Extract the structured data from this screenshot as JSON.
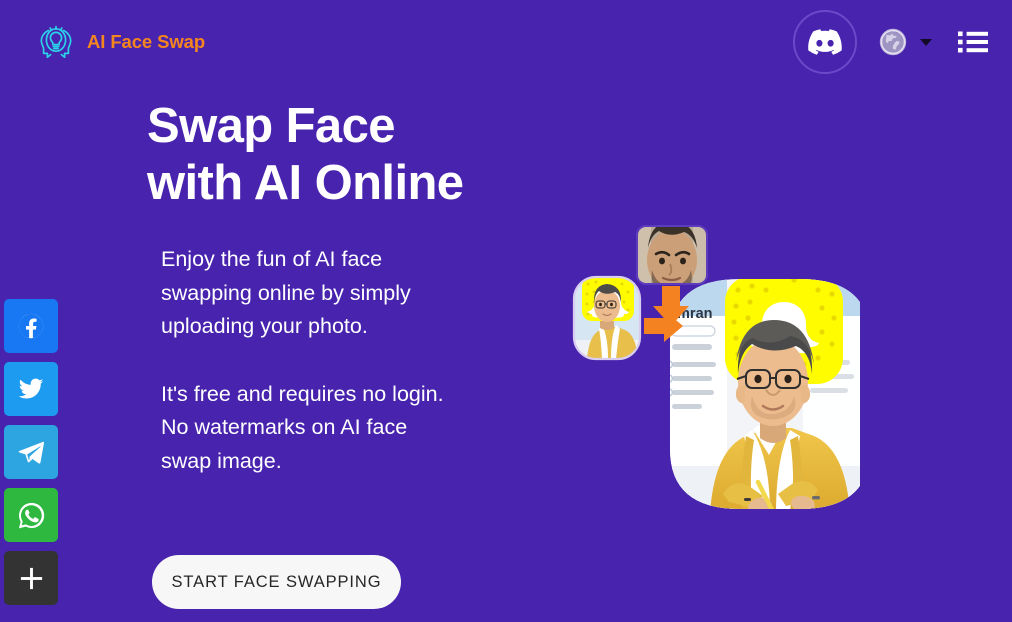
{
  "page": {
    "background_color": "#4723AE",
    "accent_orange": "#F5861F"
  },
  "header": {
    "brand": {
      "logo_icon": "head-lightbulb-icon",
      "text": "AI Face Swap",
      "text_color": "#F5861F"
    },
    "actions": [
      {
        "name": "discord-button",
        "icon": "discord-icon",
        "label": "Discord"
      },
      {
        "name": "language-selector",
        "icon": "globe-icon",
        "label": "Language"
      },
      {
        "name": "menu-button",
        "icon": "list-menu-icon",
        "label": "Menu"
      }
    ]
  },
  "social_rail": {
    "items": [
      {
        "name": "share-facebook",
        "icon": "facebook-icon",
        "label": "Facebook",
        "color": "#1877F2"
      },
      {
        "name": "share-twitter",
        "icon": "twitter-bird-icon",
        "label": "Twitter",
        "color": "#1D9BF0"
      },
      {
        "name": "share-telegram",
        "icon": "telegram-icon",
        "label": "Telegram",
        "color": "#2CA5E0"
      },
      {
        "name": "share-whatsapp",
        "icon": "whatsapp-icon",
        "label": "WhatsApp",
        "color": "#2EB83F"
      },
      {
        "name": "share-more",
        "icon": "plus-icon",
        "label": "More",
        "color": "#333333"
      }
    ]
  },
  "hero": {
    "headline": "Swap Face\nwith AI Online",
    "paragraph_1": "Enjoy the fun of AI face\nswapping online by simply\nuploading your photo.",
    "paragraph_2": "It's free and requires no login.\nNo watermarks on AI face\nswap image.",
    "cta_label": "START FACE SWAPPING",
    "artwork": {
      "source_face_thumb": "man-with-stubble-portrait",
      "target_photo_thumb": "young-man-yellow-cardigan-studying",
      "result_image": "face-swapped-young-man-yellow-cardigan",
      "profile_name": "Imran",
      "arrow_color": "#F58220",
      "ghost_background_color": "#FFFC00"
    }
  }
}
